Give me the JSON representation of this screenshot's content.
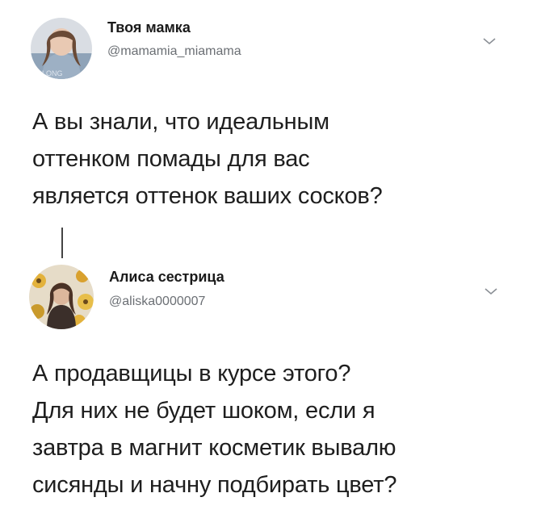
{
  "tweets": [
    {
      "display_name": "Твоя мамка",
      "handle": "@mamamia_miamama",
      "avatar_icon": "avatar-girl-photo",
      "menu_icon": "chevron-down-icon",
      "text_lines": [
        "А вы знали, что идеальным",
        "оттенком помады для вас",
        "является оттенок ваших сосков?"
      ]
    },
    {
      "display_name": "Алиса сестрица",
      "handle": "@aliska0000007",
      "avatar_icon": "avatar-girl-flowers-photo",
      "menu_icon": "chevron-down-icon",
      "text_lines": [
        "А продавщицы в курсе этого?",
        "Для них не будет шоком, если я",
        "завтра в магнит косметик вывалю",
        "сисянды и начну подбирать цвет?"
      ]
    }
  ],
  "colors": {
    "text": "#1e1e1e",
    "secondary_text": "#6b6f74",
    "background": "#ffffff",
    "thread_line": "#444444"
  }
}
